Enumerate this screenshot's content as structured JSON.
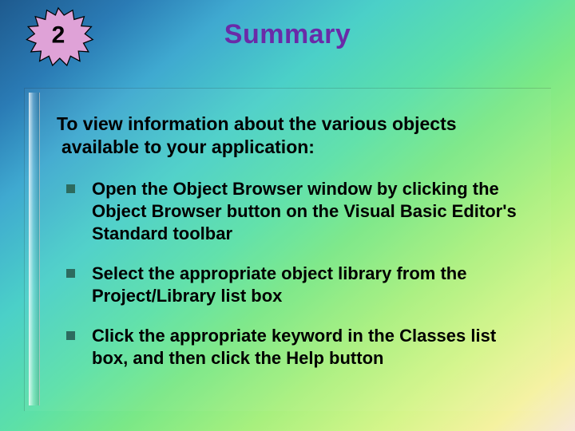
{
  "badge": {
    "number": "2"
  },
  "title": "Summary",
  "intro": "To view information about the various objects available to your application:",
  "bullets": [
    "Open the Object Browser window by clicking the Object Browser button on the Visual Basic Editor's Standard toolbar",
    "Select the appropriate object library from the Project/Library list box",
    "Click the appropriate keyword in the Classes list box, and then click the Help button"
  ],
  "colors": {
    "title": "#6a2aa8",
    "bullet_square": "#2d6b5f",
    "badge_fill": "#dfa2d7",
    "badge_stroke": "#000000"
  }
}
